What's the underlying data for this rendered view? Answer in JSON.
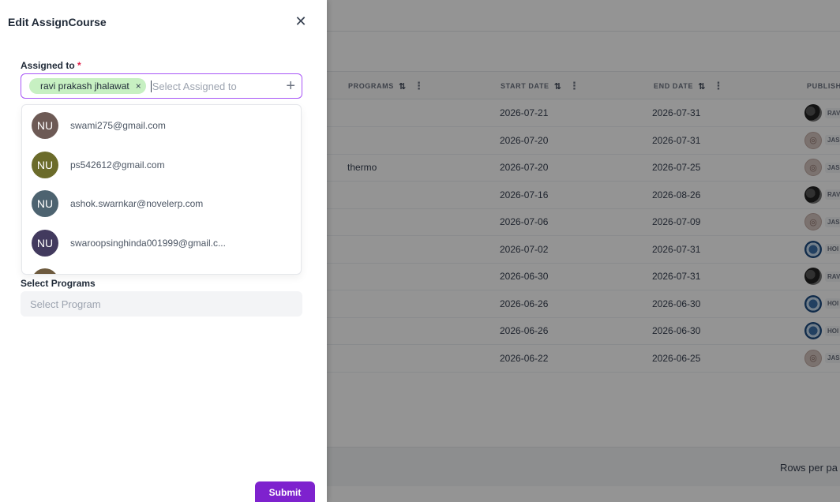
{
  "panel": {
    "title": "Edit AssignCourse",
    "close_glyph": "✕",
    "assigned_label": "Assigned to",
    "required_mark": "*",
    "chip_label": "ravi prakash jhalawat",
    "chip_remove_glyph": "×",
    "assigned_placeholder": "Select Assigned to",
    "add_glyph": "+",
    "options": [
      {
        "initials": "NU",
        "email": "swami275@gmail.com",
        "color": "#6d5a55"
      },
      {
        "initials": "NU",
        "email": "ps542612@gmail.com",
        "color": "#6b6b2a"
      },
      {
        "initials": "NU",
        "email": "ashok.swarnkar@novelerp.com",
        "color": "#4d6370"
      },
      {
        "initials": "NU",
        "email": "swaroopsinghinda001999@gmail.c...",
        "color": "#423a5e"
      },
      {
        "initials": "NU",
        "email": "",
        "color": "#6d5a3e"
      }
    ],
    "programs_label": "Select Programs",
    "programs_placeholder": "Select Program",
    "submit_label": "Submit"
  },
  "table": {
    "headers": {
      "programs": "PROGRAMS",
      "start_date": "START DATE",
      "end_date": "END DATE",
      "publisher": "PUBLISH",
      "sort_glyph": "⇅",
      "kebab_glyph": "⋮"
    },
    "rows": [
      {
        "program": "",
        "start": "2026-07-21",
        "end": "2026-07-31",
        "pub_icon": "photo-avatar-dark",
        "pub": "RAV"
      },
      {
        "program": "",
        "start": "2026-07-20",
        "end": "2026-07-31",
        "pub_icon": "user-placeholder",
        "pub": "JAS"
      },
      {
        "program": "thermo",
        "start": "2026-07-20",
        "end": "2026-07-25",
        "pub_icon": "user-placeholder",
        "pub": "JAS"
      },
      {
        "program": "",
        "start": "2026-07-16",
        "end": "2026-08-26",
        "pub_icon": "photo-avatar-dark",
        "pub": "RAV"
      },
      {
        "program": "",
        "start": "2026-07-06",
        "end": "2026-07-09",
        "pub_icon": "user-placeholder",
        "pub": "JAS"
      },
      {
        "program": "",
        "start": "2026-07-02",
        "end": "2026-07-31",
        "pub_icon": "photo-avatar-blue",
        "pub": "HOI"
      },
      {
        "program": "",
        "start": "2026-06-30",
        "end": "2026-07-31",
        "pub_icon": "photo-avatar-dark",
        "pub": "RAV"
      },
      {
        "program": "",
        "start": "2026-06-26",
        "end": "2026-06-30",
        "pub_icon": "photo-avatar-blue",
        "pub": "HOI"
      },
      {
        "program": "",
        "start": "2026-06-26",
        "end": "2026-06-30",
        "pub_icon": "photo-avatar-blue",
        "pub": "HOI"
      },
      {
        "program": "",
        "start": "2026-06-22",
        "end": "2026-06-25",
        "pub_icon": "user-placeholder",
        "pub": "JAS"
      }
    ],
    "rows_per_page_label": "Rows per pa"
  }
}
